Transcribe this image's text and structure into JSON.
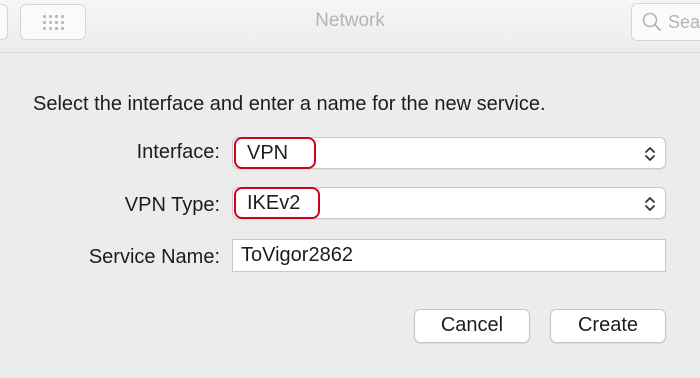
{
  "window": {
    "title": "Network",
    "search_placeholder": "Sea"
  },
  "sheet": {
    "instruction": "Select the interface and enter a name for the new service.",
    "interface": {
      "label": "Interface:",
      "value": "VPN"
    },
    "vpn_type": {
      "label": "VPN Type:",
      "value": "IKEv2"
    },
    "service_name": {
      "label": "Service Name:",
      "value": "ToVigor2862"
    },
    "buttons": {
      "cancel": "Cancel",
      "create": "Create"
    }
  },
  "annotations": {
    "highlight_color": "#d0021b"
  },
  "icons": {
    "toolbar_grid": "show-all-grid-icon",
    "search": "search-icon",
    "popup_arrows": "chevron-up-down-icon"
  }
}
